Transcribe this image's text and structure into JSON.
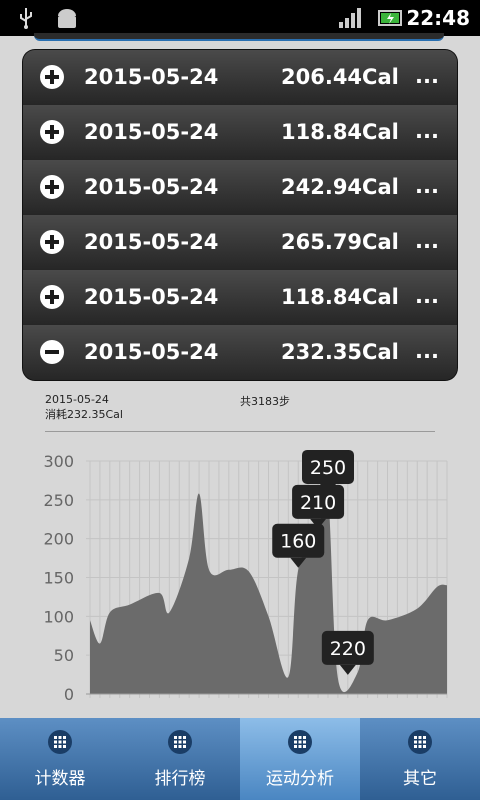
{
  "status_bar": {
    "time": "22:48",
    "icons": [
      "usb-icon",
      "android-icon",
      "signal-icon",
      "battery-charging-icon"
    ]
  },
  "records": [
    {
      "toggle": "plus",
      "date": "2015-05-24",
      "calories": "206.44Cal",
      "more": "..."
    },
    {
      "toggle": "plus",
      "date": "2015-05-24",
      "calories": "118.84Cal",
      "more": "..."
    },
    {
      "toggle": "plus",
      "date": "2015-05-24",
      "calories": "242.94Cal",
      "more": "..."
    },
    {
      "toggle": "plus",
      "date": "2015-05-24",
      "calories": "265.79Cal",
      "more": "..."
    },
    {
      "toggle": "plus",
      "date": "2015-05-24",
      "calories": "118.84Cal",
      "more": "..."
    },
    {
      "toggle": "minus",
      "date": "2015-05-24",
      "calories": "232.35Cal",
      "more": "..."
    }
  ],
  "detail": {
    "date": "2015-05-24",
    "consumed": "消耗232.35Cal",
    "steps": "共3183步"
  },
  "chart_data": {
    "type": "area",
    "ylim": [
      0,
      300
    ],
    "y_ticks": [
      0,
      50,
      100,
      150,
      200,
      250,
      300
    ],
    "x_count": 37,
    "values": [
      95,
      65,
      105,
      115,
      130,
      105,
      175,
      258,
      160,
      160,
      158,
      100,
      22,
      160,
      210,
      255,
      20,
      28,
      95,
      95,
      110,
      138,
      140
    ],
    "x_index": [
      0,
      1,
      2,
      4,
      7,
      8,
      10,
      11,
      12,
      14,
      16,
      18,
      20,
      21,
      23,
      24,
      25,
      27,
      28,
      30,
      33,
      35,
      36
    ],
    "tooltips": [
      {
        "label": "250",
        "x_index": 24,
        "value": 255
      },
      {
        "label": "210",
        "x_index": 23,
        "value": 210
      },
      {
        "label": "160",
        "x_index": 21,
        "value": 160
      },
      {
        "label": "220",
        "x_index": 26,
        "value": 22
      }
    ],
    "colors": {
      "area": "#6b6b6b",
      "grid": "#c4c4c4",
      "tooltip": "#222222"
    }
  },
  "tabs": [
    {
      "label": "计数器",
      "active": false
    },
    {
      "label": "排行榜",
      "active": false
    },
    {
      "label": "运动分析",
      "active": true
    },
    {
      "label": "其它",
      "active": false
    }
  ]
}
